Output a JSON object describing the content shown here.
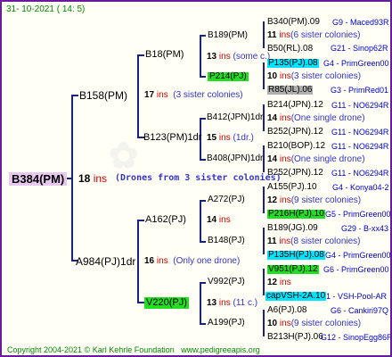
{
  "date": "31- 10-2021 ( 14:  5)",
  "root": {
    "name": "B384(PM)",
    "ins_num": "18",
    "ins_word": "ins",
    "note": "(Drones from 3 sister colonies)"
  },
  "gen1": [
    {
      "name": "B158(PM)",
      "ins_num": "17",
      "ins_word": "ins",
      "note": "(3 sister colonies)"
    },
    {
      "name": "A984(PJ)1dr",
      "ins_num": "16",
      "ins_word": "ins",
      "note": "(Only one drone)"
    }
  ],
  "gen2": [
    {
      "name": "B18(PM)",
      "ins_num": "13",
      "ins_word": "ins",
      "note": "(some c.)"
    },
    {
      "name": "B123(PM)1dr",
      "ins_num": "15",
      "ins_word": "ins",
      "note": "(1dr.)"
    },
    {
      "name": "A162(PJ)",
      "ins_num": "14",
      "ins_word": "ins",
      "note": ""
    },
    {
      "name": "V220(PJ)",
      "ins_num": "13",
      "ins_word": "ins",
      "note": "(11 c.)"
    }
  ],
  "gen3": [
    {
      "name": "B189(PM)",
      "ins_num": "11",
      "ins_word": "ins",
      "note": "(some c.)"
    },
    {
      "name": "P214(PJ)",
      "ins_num": "10",
      "ins_word": "ins",
      "note": ""
    },
    {
      "name": "B412(JPN)1dr",
      "ins_num": "14",
      "ins_word": "ins",
      "note": ""
    },
    {
      "name": "B408(JPN)1dr",
      "ins_num": "",
      "ins_word": "",
      "note": ""
    },
    {
      "name": "A272(PJ)",
      "ins_num": "14",
      "ins_word": "ins",
      "note": ""
    },
    {
      "name": "B148(PJ)",
      "ins_num": "",
      "ins_word": "",
      "note": ""
    },
    {
      "name": "V992(PJ)",
      "ins_num": "12",
      "ins_word": "ins",
      "note": ""
    },
    {
      "name": "A199(PJ)",
      "ins_num": "",
      "ins_word": "",
      "note": ""
    }
  ],
  "gen4": [
    {
      "name": "B340(PM).09",
      "src": "G9 - Maced93R"
    },
    {
      "ins_num": "11",
      "ins_word": "ins",
      "note": "(6 sister colonies)"
    },
    {
      "name": "B50(RL).08",
      "src": "G21 - Sinop62R"
    },
    {
      "name": "P135(PJ).08",
      "src": "G4 - PrimGreen00"
    },
    {
      "ins_num": "10",
      "ins_word": "ins",
      "note": "(3 sister colonies)"
    },
    {
      "name": "R85(JL).06",
      "src": "G3 - PrimRed01"
    },
    {
      "name": "B214(JPN).12",
      "src": "G11 - NO6294R"
    },
    {
      "ins_num": "14",
      "ins_word": "ins",
      "note": "(One single drone)"
    },
    {
      "name": "B252(JPN).12",
      "src": "G11 - NO6294R"
    },
    {
      "name": "B210(BOP).12",
      "src": "G11 - NO6294R"
    },
    {
      "ins_num": "14",
      "ins_word": "ins",
      "note": "(One single drone)"
    },
    {
      "name": "B252(JPN).12",
      "src": "G11 - NO6294R"
    },
    {
      "name": "A155(PJ).10",
      "src": "G4 - Konya04-2"
    },
    {
      "ins_num": "12",
      "ins_word": "ins",
      "note": "(9 sister colonies)"
    },
    {
      "name": "P216H(PJ).10",
      "src": "G5 - PrimGreen00"
    },
    {
      "name": "B189(JG).09",
      "src": "G29 - B-xx43"
    },
    {
      "ins_num": "11",
      "ins_word": "ins",
      "note": "(8 sister colonies)"
    },
    {
      "name": "P135H(PJ).08",
      "src": "G4 - PrimGreen00"
    },
    {
      "name": "V951(PJ).12",
      "src": "G6 - PrimGreen00"
    },
    {
      "ins_num": "12",
      "ins_word": "ins",
      "note": ""
    },
    {
      "name": "capVSH-2A.10",
      "src": "1 - VSH-Pool-AR"
    },
    {
      "name": "A6(PJ).08",
      "src": "G6 - Cankiri97Q"
    },
    {
      "ins_num": "10",
      "ins_word": "ins",
      "note": "(9 sister colonies)"
    },
    {
      "name": "B213H(PJ).06",
      "src": "G12 - SinopEgg86R"
    }
  ],
  "footer": {
    "copyright": "Copyright 2004-2021 © Karl Kehrle Foundation",
    "site": "www.pedigreeapis.org"
  }
}
